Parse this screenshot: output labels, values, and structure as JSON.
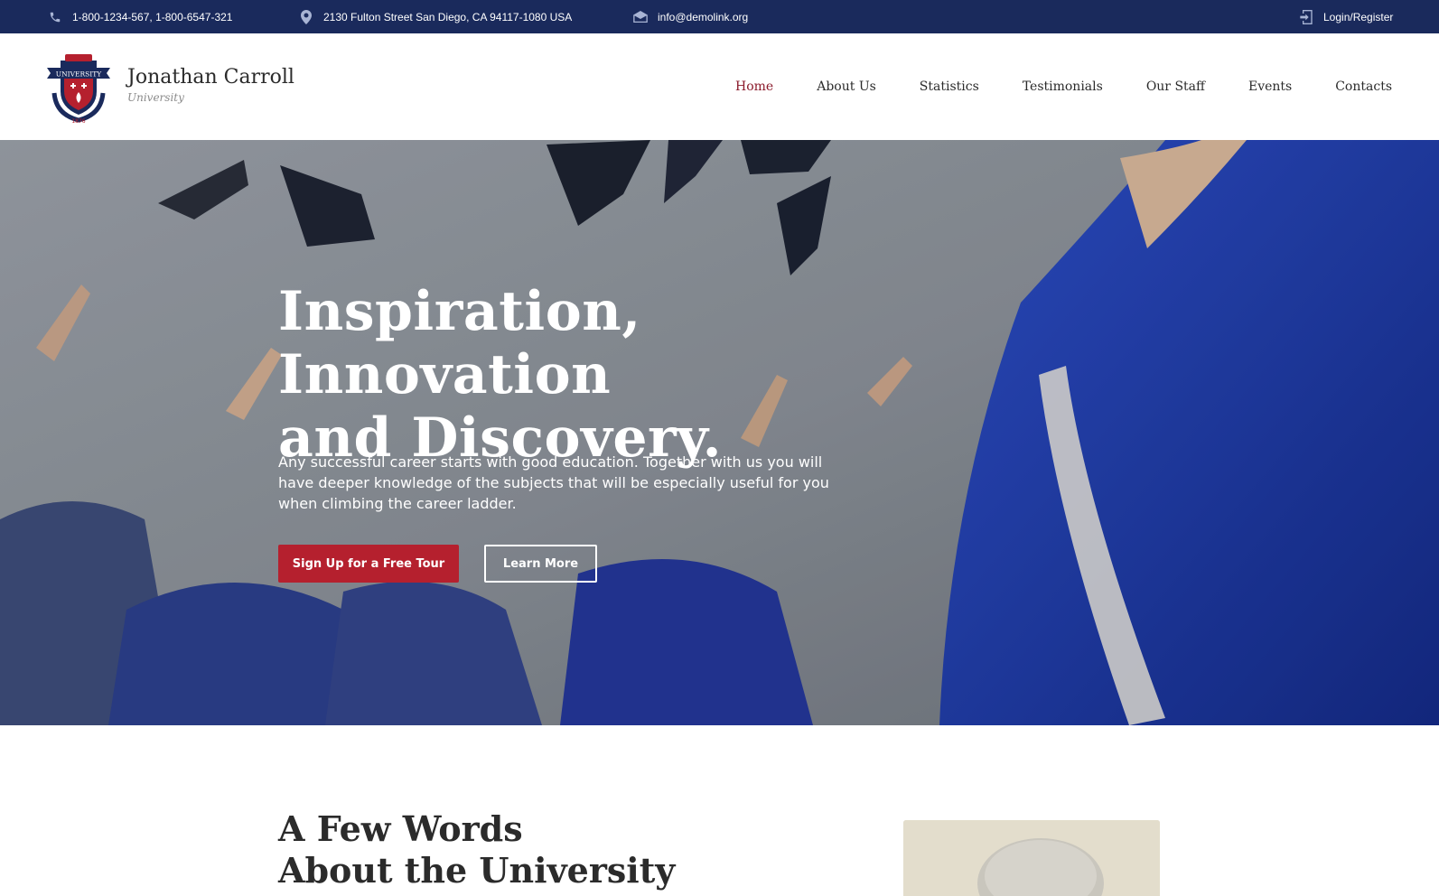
{
  "topbar": {
    "phones": "1-800-1234-567, 1-800-6547-321",
    "address": "2130 Fulton Street San Diego, CA 94117-1080 USA",
    "email": "info@demolink.org",
    "login": "Login/Register"
  },
  "brand": {
    "name": "Jonathan Carroll",
    "sub": "University",
    "crest_banner": "UNIVERSITY",
    "crest_year": "1876"
  },
  "nav": {
    "items": [
      {
        "label": "Home",
        "active": true
      },
      {
        "label": "About Us"
      },
      {
        "label": "Statistics"
      },
      {
        "label": "Testimonials"
      },
      {
        "label": "Our Staff"
      },
      {
        "label": "Events"
      },
      {
        "label": "Contacts"
      }
    ]
  },
  "hero": {
    "title_line1": "Inspiration, Innovation",
    "title_line2": "and Discovery.",
    "text": "Any successful career starts with good education. Together with us you will have deeper knowledge of the subjects that will be especially useful for you when climbing the career ladder.",
    "primary_button": "Sign Up for a Free Tour",
    "secondary_button": "Learn More"
  },
  "about": {
    "title_line1": "A Few Words",
    "title_line2": "About the University"
  },
  "colors": {
    "topbar_bg": "#1a2a5c",
    "accent_red": "#b5202e",
    "nav_active": "#8b1a2b",
    "gown_blue": "#1e3aa8"
  },
  "icons": [
    "phone-icon",
    "location-pin-icon",
    "envelope-icon",
    "login-icon",
    "university-crest-logo"
  ]
}
